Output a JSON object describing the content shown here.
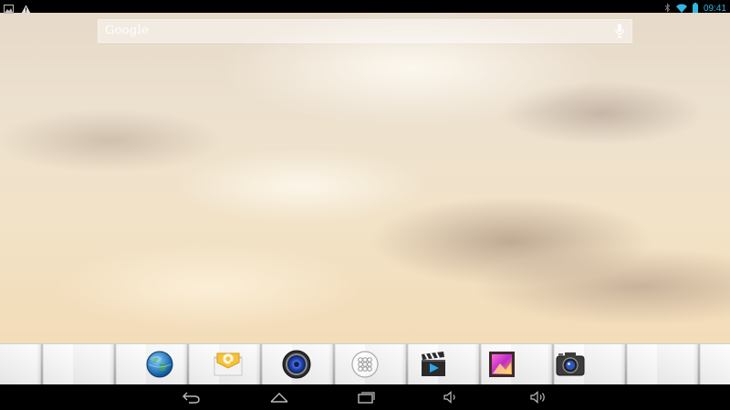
{
  "status_bar": {
    "time": "09:41",
    "left_icons": [
      "image-notification-icon",
      "warning-icon"
    ],
    "right_icons": [
      "bluetooth-icon",
      "wifi-icon",
      "battery-icon"
    ],
    "accent": "#33b5e5"
  },
  "search": {
    "logo_text": "Google",
    "mic_icon": "mic-icon"
  },
  "dock": {
    "items": [
      {
        "name": "browser-icon"
      },
      {
        "name": "email-icon"
      },
      {
        "name": "music-icon"
      },
      {
        "name": "all-apps-icon"
      },
      {
        "name": "video-player-icon"
      },
      {
        "name": "gallery-icon"
      },
      {
        "name": "camera-icon"
      }
    ]
  },
  "nav_bar": {
    "buttons": [
      "back-icon",
      "home-icon",
      "recent-apps-icon",
      "volume-down-icon",
      "volume-up-icon"
    ]
  }
}
